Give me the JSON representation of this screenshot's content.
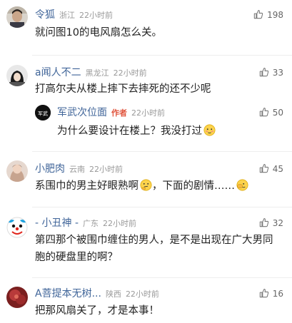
{
  "comments": [
    {
      "name": "令狐",
      "location": "浙江",
      "time": "22小时前",
      "likes": "198",
      "text": "就问图10的电风扇怎么关。"
    },
    {
      "name": "a闻人不二",
      "location": "黑龙江",
      "time": "22小时前",
      "likes": "33",
      "text": "打高尔夫从楼上摔下去摔死的还不少呢",
      "reply": {
        "name": "军武次位面",
        "author_tag": "作者",
        "time": "22小时前",
        "likes": "50",
        "text": "为什么要设计在楼上？我没打过",
        "avatar_text": "军武"
      }
    },
    {
      "name": "小肥肉",
      "location": "云南",
      "time": "22小时前",
      "likes": "45",
      "text_a": "系围巾的男主好眼熟啊",
      "text_b": "，下面的剧情……"
    },
    {
      "name": "- 小丑神 -",
      "location": "广东",
      "time": "22小时前",
      "likes": "32",
      "text": "第四那个被围巾缠住的男人，是不是出现在广大男同胞的硬盘里的啊？"
    },
    {
      "name": "A菩提本无树...",
      "location": "陕西",
      "time": "22小时前",
      "likes": "16",
      "text": "把那风扇关了，才是本事！"
    }
  ],
  "icons": {
    "like": "thumbs-up-icon",
    "emoji_smile": "embarrassed-face-emoji",
    "emoji_think": "thinking-face-emoji",
    "emoji_cover": "hiding-face-emoji"
  },
  "colors": {
    "name": "#406599",
    "meta": "#999999",
    "author_tag": "#e0553e",
    "text": "#222222"
  }
}
